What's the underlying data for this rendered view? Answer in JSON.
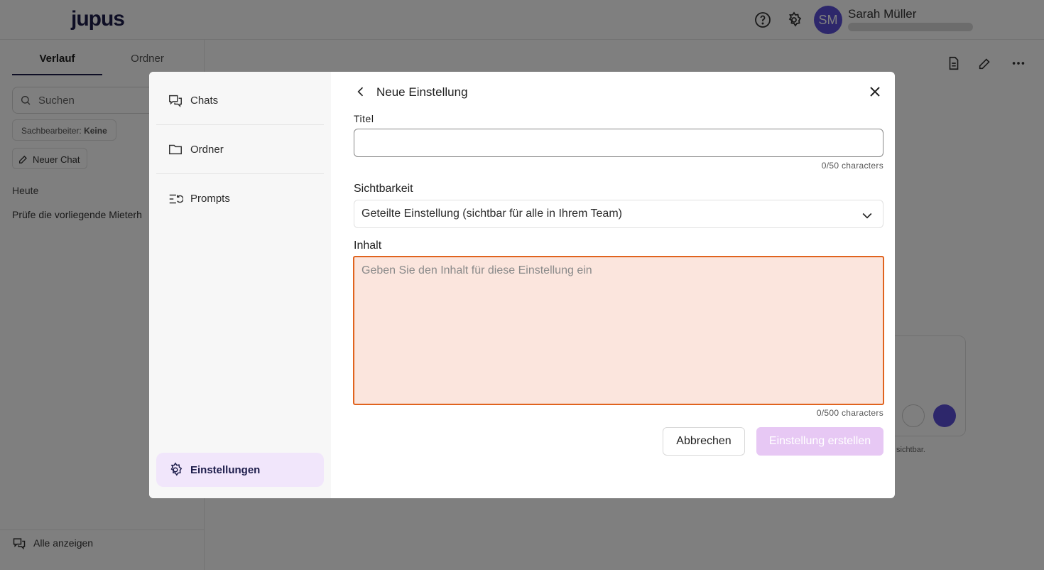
{
  "app": {
    "logo": "jupus",
    "user_initials": "SM",
    "user_name": "Sarah Müller"
  },
  "sidebar": {
    "tabs": [
      {
        "label": "Verlauf",
        "active": true
      },
      {
        "label": "Ordner",
        "active": false
      }
    ],
    "search_placeholder": "Suchen",
    "filter_label": "Sachbearbeiter:",
    "filter_value": "Keine",
    "new_chat": "Neuer Chat",
    "today": "Heute",
    "chat_item": "Prüfe die vorliegende Mieterh",
    "show_all": "Alle anzeigen"
  },
  "main": {
    "composer_note": "sichtbar."
  },
  "modal": {
    "nav": [
      {
        "label": "Chats",
        "icon": "chats-icon"
      },
      {
        "label": "Ordner",
        "icon": "folder-icon"
      },
      {
        "label": "Prompts",
        "icon": "prompts-icon"
      }
    ],
    "nav_active": {
      "label": "Einstellungen",
      "icon": "gear-icon"
    },
    "title": "Neue Einstellung",
    "title_field": {
      "label": "Titel",
      "value": "",
      "counter": "0/50 characters"
    },
    "visibility": {
      "label": "Sichtbarkeit",
      "selected": "Geteilte Einstellung (sichtbar für alle in Ihrem Team)"
    },
    "content_field": {
      "label": "Inhalt",
      "placeholder": "Geben Sie den Inhalt für diese Einstellung ein",
      "counter": "0/500 characters"
    },
    "cancel": "Abbrechen",
    "create": "Einstellung erstellen"
  },
  "colors": {
    "accent": "#5b4fd6",
    "error_border": "#e0631e",
    "error_bg": "#fbe5dd",
    "active_nav": "#f1e6fb",
    "disabled_button": "#e7c8f4"
  }
}
